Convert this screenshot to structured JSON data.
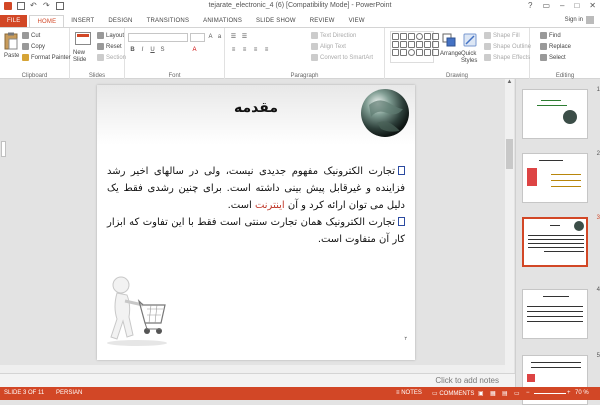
{
  "window": {
    "title": "tejarate_electronic_4 (6) [Compatibility Mode] - PowerPoint",
    "controls": [
      "?",
      "▭",
      "–",
      "□",
      "✕"
    ]
  },
  "tabs": [
    {
      "label": "FILE"
    },
    {
      "label": "HOME"
    },
    {
      "label": "INSERT"
    },
    {
      "label": "DESIGN"
    },
    {
      "label": "TRANSITIONS"
    },
    {
      "label": "ANIMATIONS"
    },
    {
      "label": "SLIDE SHOW"
    },
    {
      "label": "REVIEW"
    },
    {
      "label": "VIEW"
    }
  ],
  "signin": "Sign in",
  "ribbon": {
    "clipboard": {
      "label": "Clipboard",
      "paste": "Paste",
      "cut": "Cut",
      "copy": "Copy",
      "format_painter": "Format Painter"
    },
    "slides": {
      "label": "Slides",
      "new_slide": "New Slide",
      "layout": "Layout",
      "reset": "Reset",
      "section": "Section"
    },
    "font": {
      "label": "Font"
    },
    "paragraph": {
      "label": "Paragraph",
      "text_direction": "Text Direction",
      "align_text": "Align Text",
      "convert": "Convert to SmartArt"
    },
    "drawing": {
      "label": "Drawing",
      "arrange": "Arrange",
      "quick_styles": "Quick Styles",
      "shape_fill": "Shape Fill",
      "shape_outline": "Shape Outline",
      "shape_effects": "Shape Effects"
    },
    "editing": {
      "label": "Editing",
      "find": "Find",
      "replace": "Replace",
      "select": "Select"
    }
  },
  "slide": {
    "title": "مقدمه",
    "p1_a": "تجارت الکترونیک مفهوم جدیدی نیست، ولی در سالهای اخیر رشد فزاینده و غیرقابل پیش بینی داشته است. برای چنین رشدی فقط یک دلیل می توان ارائه کرد و آن ",
    "p1_highlight": "اینترنت",
    "p1_b": " است.",
    "p2": "تجارت الکترونیک همان تجارت سنتی است فقط با این تفاوت که ابزار کار آن متفاوت است.",
    "page_number": "۲"
  },
  "thumbnails": [
    {
      "num": "1",
      "selected": false
    },
    {
      "num": "2",
      "selected": false
    },
    {
      "num": "3",
      "selected": true
    },
    {
      "num": "4",
      "selected": false
    },
    {
      "num": "5",
      "selected": false
    }
  ],
  "notes_placeholder": "Click to add notes",
  "status": {
    "slide": "SLIDE 3 OF 11",
    "language": "PERSIAN",
    "notes": "NOTES",
    "comments": "COMMENTS",
    "zoom": "70 %"
  },
  "colors": {
    "accent": "#d24726",
    "bullet": "#2b4aa0",
    "highlight": "#c0392b"
  }
}
